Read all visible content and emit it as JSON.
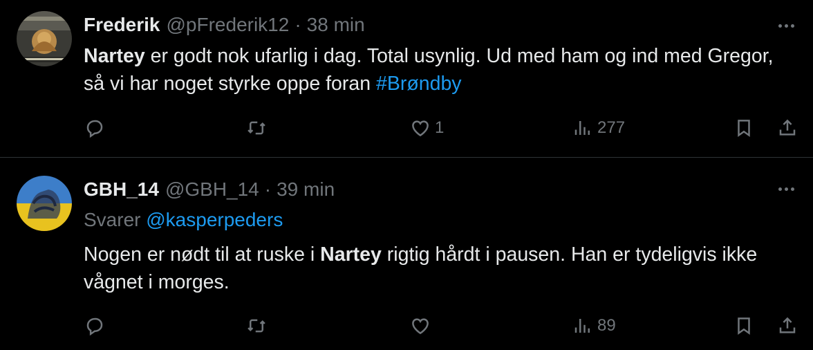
{
  "tweets": [
    {
      "name": "Frederik",
      "handle": "@pFrederik12",
      "separator": "·",
      "time": "38 min",
      "text": {
        "bold": "Nartey",
        "rest": " er godt nok ufarlig i dag. Total usynlig. Ud med ham og ind med Gregor, så vi har noget styrke oppe foran ",
        "hashtag": "#Brøndby"
      },
      "counts": {
        "replies": "",
        "retweets": "",
        "likes": "1",
        "views": "277"
      }
    },
    {
      "name": "GBH_14",
      "handle": "@GBH_14",
      "separator": "·",
      "time": "39 min",
      "replying_label": "Svarer ",
      "replying_to": "@kasperpeders",
      "text": {
        "before": "Nogen er nødt til at ruske i ",
        "bold": "Nartey",
        "after": " rigtig hårdt i pausen. Han er tydeligvis ikke vågnet i morges."
      },
      "counts": {
        "replies": "",
        "retweets": "",
        "likes": "",
        "views": "89"
      }
    }
  ],
  "colors": {
    "background": "#000000",
    "text": "#e7e9ea",
    "secondary": "#71767b",
    "link": "#1d9bf0",
    "divider": "#2f3336"
  },
  "icons": [
    "reply-icon",
    "retweet-icon",
    "like-icon",
    "views-icon",
    "bookmark-icon",
    "share-icon",
    "more-icon"
  ]
}
